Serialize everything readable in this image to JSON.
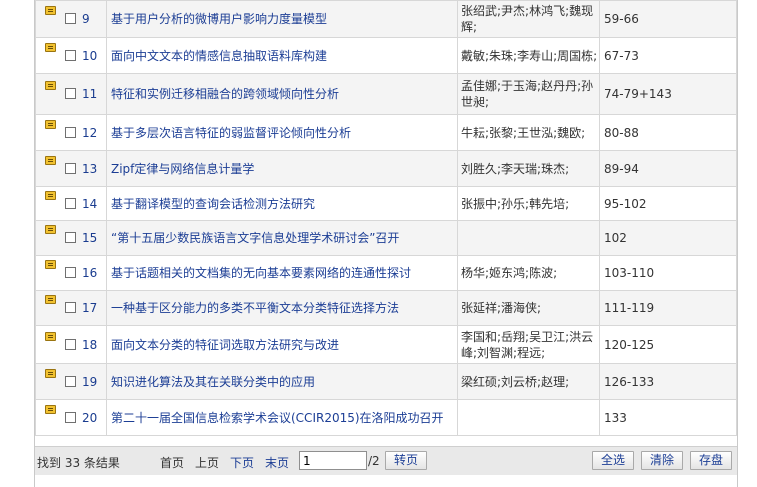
{
  "results": [
    {
      "num": "9",
      "title": "基于用户分析的微博用户影响力度量模型",
      "authors": "张绍武;尹杰;林鸿飞;魏现辉;",
      "pages": "59-66"
    },
    {
      "num": "10",
      "title": "面向中文文本的情感信息抽取语料库构建",
      "authors": "戴敏;朱珠;李寿山;周国栋;",
      "pages": "67-73"
    },
    {
      "num": "11",
      "title": "特征和实例迁移相融合的跨领域倾向性分析",
      "authors": "孟佳娜;于玉海;赵丹丹;孙世昶;",
      "pages": "74-79+143"
    },
    {
      "num": "12",
      "title": "基于多层次语言特征的弱监督评论倾向性分析",
      "authors": "牛耘;张黎;王世泓;魏欧;",
      "pages": "80-88"
    },
    {
      "num": "13",
      "title": "Zipf定律与网络信息计量学",
      "authors": "刘胜久;李天瑞;珠杰;",
      "pages": "89-94"
    },
    {
      "num": "14",
      "title": "基于翻译模型的查询会话检测方法研究",
      "authors": "张振中;孙乐;韩先培;",
      "pages": "95-102"
    },
    {
      "num": "15",
      "title": "“第十五届少数民族语言文字信息处理学术研讨会”召开",
      "authors": "",
      "pages": "102"
    },
    {
      "num": "16",
      "title": "基于话题相关的文档集的无向基本要素网络的连通性探讨",
      "authors": "杨华;姬东鸿;陈波;",
      "pages": "103-110"
    },
    {
      "num": "17",
      "title": "一种基于区分能力的多类不平衡文本分类特征选择方法",
      "authors": "张延祥;潘海侠;",
      "pages": "111-119"
    },
    {
      "num": "18",
      "title": "面向文本分类的特征词选取方法研究与改进",
      "authors": "李国和;岳翔;吴卫江;洪云峰;刘智渊;程远;",
      "pages": "120-125"
    },
    {
      "num": "19",
      "title": "知识进化算法及其在关联分类中的应用",
      "authors": "梁红硕;刘云桥;赵理;",
      "pages": "126-133"
    },
    {
      "num": "20",
      "title": "第二十一届全国信息检索学术会议(CCIR2015)在洛阳成功召开",
      "authors": "",
      "pages": "133"
    }
  ],
  "footer": {
    "found_text": "找到 33 条结果",
    "first": "首页",
    "prev": "上页",
    "next": "下页",
    "last": "末页",
    "page_value": "1",
    "page_total": "/2",
    "go": "转页",
    "select_all": "全选",
    "clear": "清除",
    "save": "存盘"
  }
}
